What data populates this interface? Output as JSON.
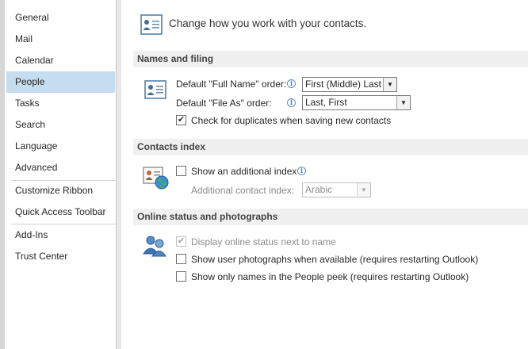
{
  "sidebar": {
    "items": [
      {
        "label": "General"
      },
      {
        "label": "Mail"
      },
      {
        "label": "Calendar"
      },
      {
        "label": "People"
      },
      {
        "label": "Tasks"
      },
      {
        "label": "Search"
      },
      {
        "label": "Language"
      },
      {
        "label": "Advanced"
      },
      {
        "label": "Customize Ribbon"
      },
      {
        "label": "Quick Access Toolbar"
      },
      {
        "label": "Add-Ins"
      },
      {
        "label": "Trust Center"
      }
    ],
    "selected": "People"
  },
  "main": {
    "intro": "Change how you work with your contacts.",
    "names_filing": {
      "header": "Names and filing",
      "full_name_label": "Default \"Full Name\" order:",
      "full_name_value": "First (Middle) Last",
      "file_as_label": "Default \"File As\" order:",
      "file_as_value": "Last, First",
      "duplicates_label": "Check for duplicates when saving new contacts",
      "duplicates_checked": true
    },
    "contacts_index": {
      "header": "Contacts index",
      "show_label": "Show an additional index",
      "show_checked": false,
      "additional_label": "Additional contact index:",
      "additional_value": "Arabic"
    },
    "online_status": {
      "header": "Online status and photographs",
      "display_status_label": "Display online status next to name",
      "display_status_checked": true,
      "show_photos_label": "Show user photographs when available (requires restarting Outlook)",
      "show_photos_checked": false,
      "show_names_label": "Show only names in the People peek (requires restarting Outlook)",
      "show_names_checked": false
    }
  },
  "colors": {
    "selected_nav": "#c5dcf1",
    "section_header_bg": "#f0f0f0",
    "info_icon": "#3a78b8"
  }
}
